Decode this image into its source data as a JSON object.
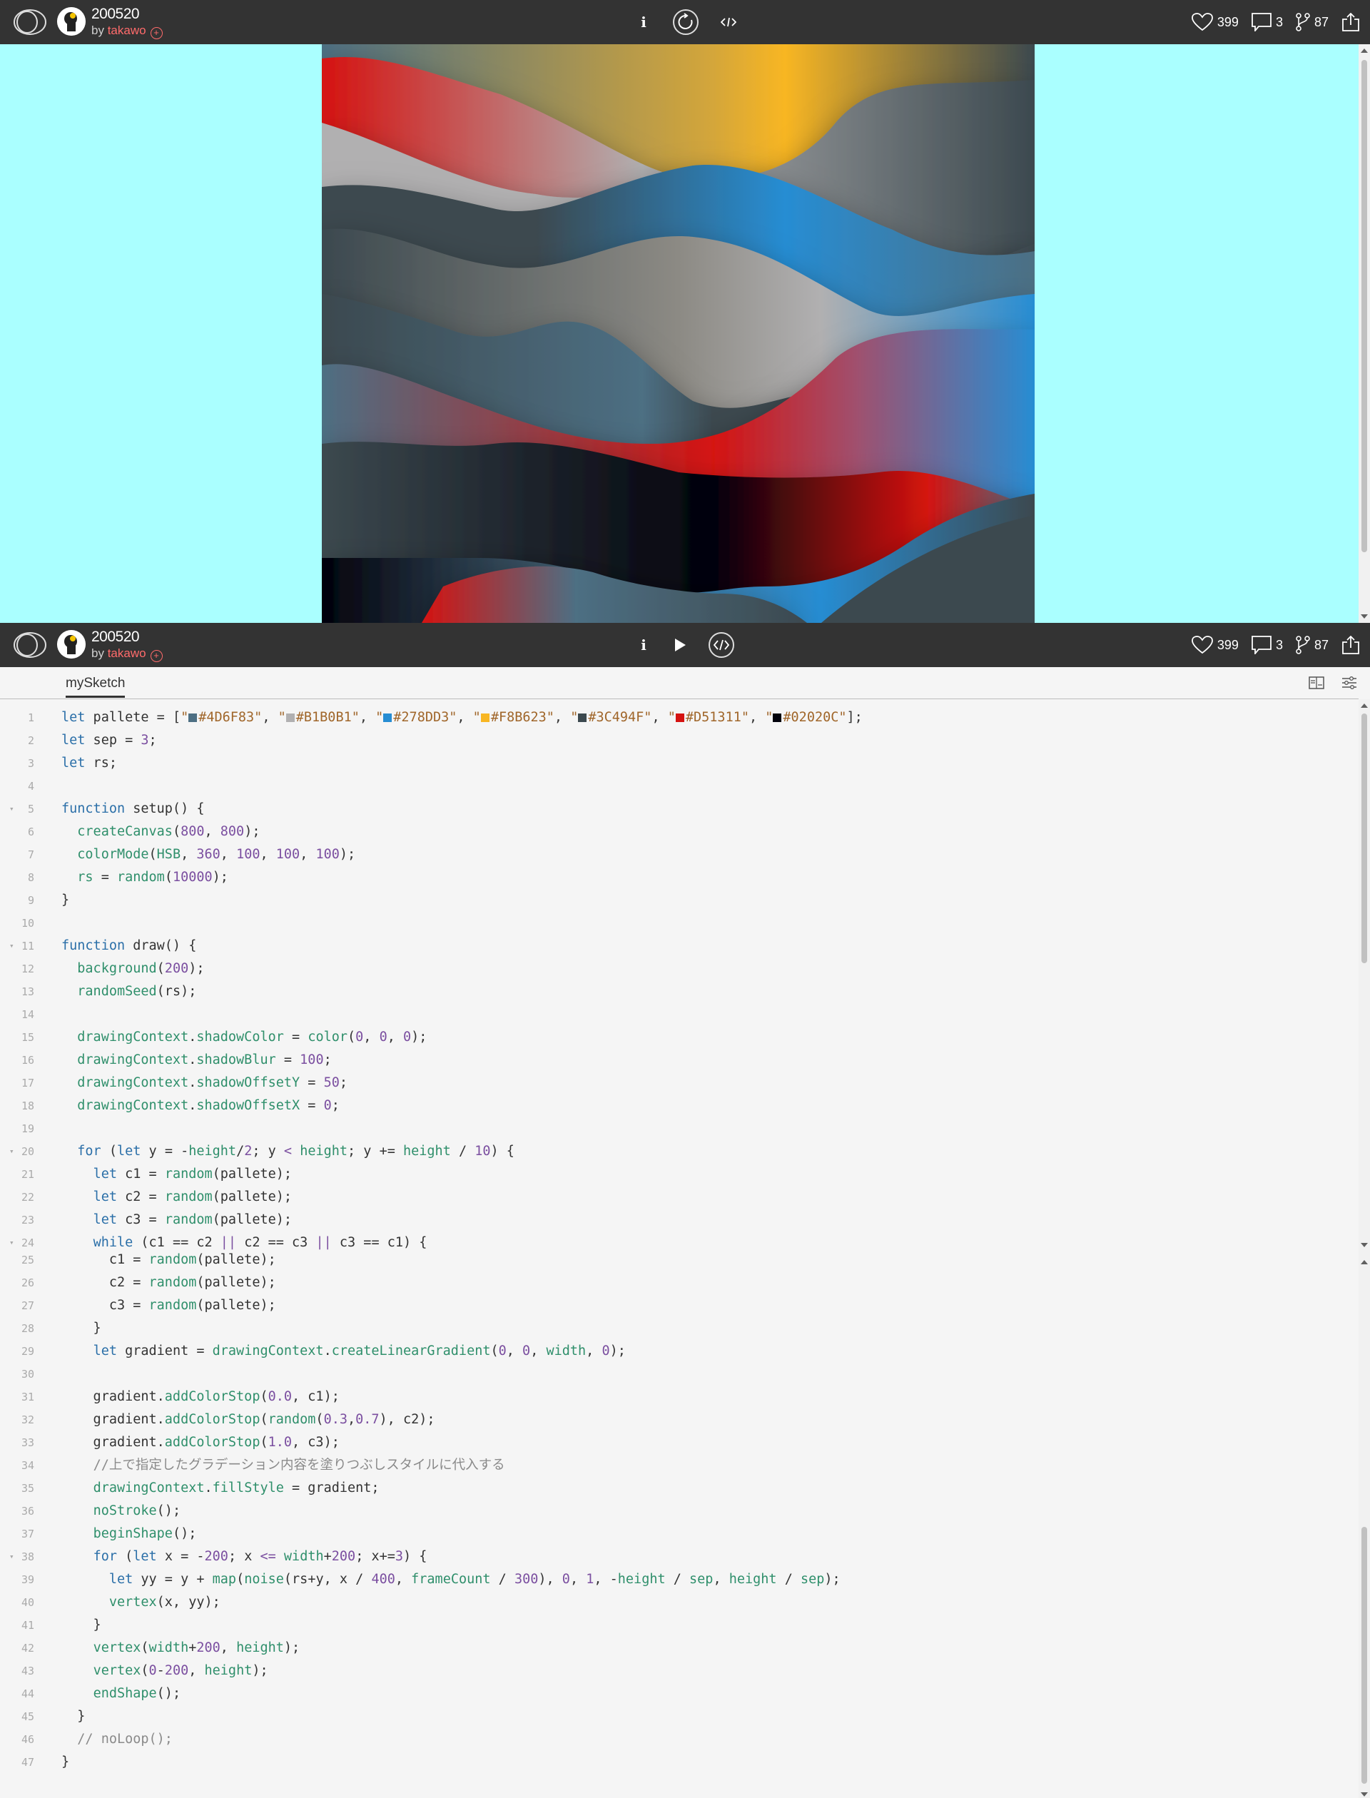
{
  "header": {
    "sketch_title": "200520",
    "by_label": "by",
    "author": "takawo",
    "likes": "399",
    "comments": "3",
    "forks": "87",
    "info_label": "i"
  },
  "tab": {
    "label": "mySketch"
  },
  "colors": {
    "preview_background": "#AAFFFF",
    "bar": "#333333",
    "author": "#FF6B6B"
  },
  "icons": [
    "openprocessing-logo-icon",
    "avatar",
    "follow-plus-icon",
    "info-icon",
    "restart-icon",
    "code-icon",
    "play-icon",
    "heart-icon",
    "comment-icon",
    "fork-icon",
    "share-icon",
    "layout-icon",
    "settings-icon"
  ],
  "code_lines": [
    {
      "n": "1",
      "html": "<span class='kw'>let</span> pallete = [<span class='str'>\"</span><span class='sw' style='background:#4D6F83'></span><span class='str'>#4D6F83\"</span>, <span class='str'>\"</span><span class='sw' style='background:#B1B0B1'></span><span class='str'>#B1B0B1\"</span>, <span class='str'>\"</span><span class='sw' style='background:#278DD3'></span><span class='str'>#278DD3\"</span>, <span class='str'>\"</span><span class='sw' style='background:#F8B623'></span><span class='str'>#F8B623\"</span>, <span class='str'>\"</span><span class='sw' style='background:#3C494F'></span><span class='str'>#3C494F\"</span>, <span class='str'>\"</span><span class='sw' style='background:#D51311'></span><span class='str'>#D51311\"</span>, <span class='str'>\"</span><span class='sw' style='background:#02020C'></span><span class='str'>#02020C\"</span>];"
    },
    {
      "n": "2",
      "html": "<span class='kw'>let</span> sep = <span class='num'>3</span>;"
    },
    {
      "n": "3",
      "html": "<span class='kw'>let</span> rs;"
    },
    {
      "n": "4",
      "html": ""
    },
    {
      "n": "5",
      "fold": true,
      "html": "<span class='kw'>function</span> setup() {"
    },
    {
      "n": "6",
      "html": "  <span class='fn'>createCanvas</span>(<span class='num'>800</span>, <span class='num'>800</span>);"
    },
    {
      "n": "7",
      "html": "  <span class='fn'>colorMode</span>(<span class='fn'>HSB</span>, <span class='num'>360</span>, <span class='num'>100</span>, <span class='num'>100</span>, <span class='num'>100</span>);"
    },
    {
      "n": "8",
      "html": "  <span class='fn'>rs</span> = <span class='fn'>random</span>(<span class='num'>10000</span>);"
    },
    {
      "n": "9",
      "html": "}"
    },
    {
      "n": "10",
      "html": ""
    },
    {
      "n": "11",
      "fold": true,
      "html": "<span class='kw'>function</span> draw() {"
    },
    {
      "n": "12",
      "html": "  <span class='fn'>background</span>(<span class='num'>200</span>);"
    },
    {
      "n": "13",
      "html": "  <span class='fn'>randomSeed</span>(rs);"
    },
    {
      "n": "14",
      "html": ""
    },
    {
      "n": "15",
      "html": "  <span class='fn'>drawingContext</span>.<span class='fn'>shadowColor</span> = <span class='fn'>color</span>(<span class='num'>0</span>, <span class='num'>0</span>, <span class='num'>0</span>);"
    },
    {
      "n": "16",
      "html": "  <span class='fn'>drawingContext</span>.<span class='fn'>shadowBlur</span> = <span class='num'>100</span>;"
    },
    {
      "n": "17",
      "html": "  <span class='fn'>drawingContext</span>.<span class='fn'>shadowOffsetY</span> = <span class='num'>50</span>;"
    },
    {
      "n": "18",
      "html": "  <span class='fn'>drawingContext</span>.<span class='fn'>shadowOffsetX</span> = <span class='num'>0</span>;"
    },
    {
      "n": "19",
      "html": ""
    },
    {
      "n": "20",
      "fold": true,
      "html": "  <span class='kw'>for</span> (<span class='kw'>let</span> y = -<span class='fn'>height</span>/<span class='num'>2</span>; y <span class='op'>&lt;</span> <span class='fn'>height</span>; y += <span class='fn'>height</span> / <span class='num'>10</span>) {"
    },
    {
      "n": "21",
      "html": "    <span class='kw'>let</span> c1 = <span class='fn'>random</span>(pallete);"
    },
    {
      "n": "22",
      "html": "    <span class='kw'>let</span> c2 = <span class='fn'>random</span>(pallete);"
    },
    {
      "n": "23",
      "html": "    <span class='kw'>let</span> c3 = <span class='fn'>random</span>(pallete);"
    },
    {
      "n": "24",
      "fold": true,
      "html": "    <span class='kw'>while</span> (c1 == c2 <span class='op'>||</span> c2 == c3 <span class='op'>||</span> c3 == c1) {"
    },
    {
      "n": "25",
      "html": "      c1 = <span class='fn'>random</span>(pallete);"
    },
    {
      "n": "26",
      "html": "      c2 = <span class='fn'>random</span>(pallete);"
    },
    {
      "n": "27",
      "html": "      c3 = <span class='fn'>random</span>(pallete);"
    },
    {
      "n": "28",
      "html": "    }"
    },
    {
      "n": "29",
      "html": "    <span class='kw'>let</span> gradient = <span class='fn'>drawingContext</span>.<span class='fn'>createLinearGradient</span>(<span class='num'>0</span>, <span class='num'>0</span>, <span class='fn'>width</span>, <span class='num'>0</span>);"
    },
    {
      "n": "30",
      "html": ""
    },
    {
      "n": "31",
      "html": "    gradient.<span class='fn'>addColorStop</span>(<span class='num'>0.0</span>, c1);"
    },
    {
      "n": "32",
      "html": "    gradient.<span class='fn'>addColorStop</span>(<span class='fn'>random</span>(<span class='num'>0.3</span>,<span class='num'>0.7</span>), c2);"
    },
    {
      "n": "33",
      "html": "    gradient.<span class='fn'>addColorStop</span>(<span class='num'>1.0</span>, c3);"
    },
    {
      "n": "34",
      "html": "    <span class='cmt'>//上で指定したグラデーション内容を塗りつぶしスタイルに代入する</span>"
    },
    {
      "n": "35",
      "html": "    <span class='fn'>drawingContext</span>.<span class='fn'>fillStyle</span> = gradient;"
    },
    {
      "n": "36",
      "html": "    <span class='fn'>noStroke</span>();"
    },
    {
      "n": "37",
      "html": "    <span class='fn'>beginShape</span>();"
    },
    {
      "n": "38",
      "fold": true,
      "html": "    <span class='kw'>for</span> (<span class='kw'>let</span> x = -<span class='num'>200</span>; x <span class='op'>&lt;=</span> <span class='fn'>width</span>+<span class='num'>200</span>; x+=<span class='num'>3</span>) {"
    },
    {
      "n": "39",
      "html": "      <span class='kw'>let</span> yy = y + <span class='fn'>map</span>(<span class='fn'>noise</span>(rs+y, x / <span class='num'>400</span>, <span class='fn'>frameCount</span> / <span class='num'>300</span>), <span class='num'>0</span>, <span class='num'>1</span>, -<span class='fn'>height</span> / <span class='fn'>sep</span>, <span class='fn'>height</span> / <span class='fn'>sep</span>);"
    },
    {
      "n": "40",
      "html": "      <span class='fn'>vertex</span>(x, yy);"
    },
    {
      "n": "41",
      "html": "    }"
    },
    {
      "n": "42",
      "html": "    <span class='fn'>vertex</span>(<span class='fn'>width</span>+<span class='num'>200</span>, <span class='fn'>height</span>);"
    },
    {
      "n": "43",
      "html": "    <span class='fn'>vertex</span>(<span class='num'>0</span>-<span class='num'>200</span>, <span class='fn'>height</span>);"
    },
    {
      "n": "44",
      "html": "    <span class='fn'>endShape</span>();"
    },
    {
      "n": "45",
      "html": "  }"
    },
    {
      "n": "46",
      "html": "  <span class='cmt'>// noLoop();</span>"
    },
    {
      "n": "47",
      "html": "}"
    }
  ]
}
